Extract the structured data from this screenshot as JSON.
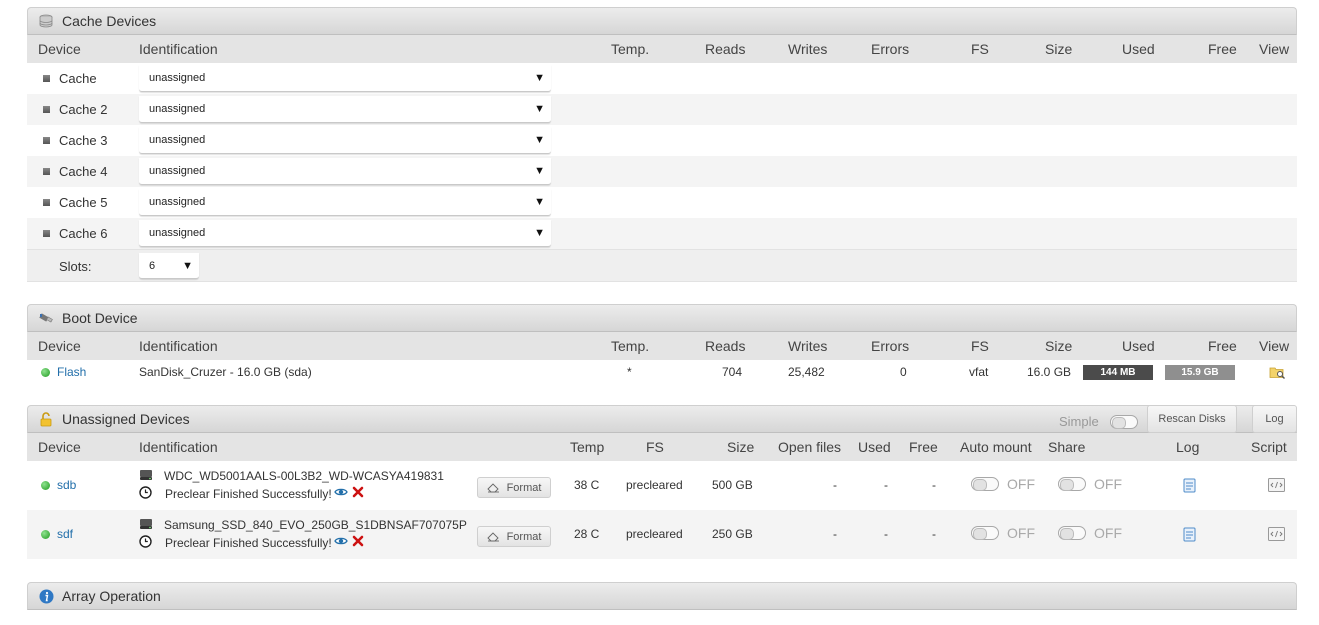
{
  "cache": {
    "title": "Cache Devices",
    "headers": {
      "device": "Device",
      "identification": "Identification",
      "temp": "Temp.",
      "reads": "Reads",
      "writes": "Writes",
      "errors": "Errors",
      "fs": "FS",
      "size": "Size",
      "used": "Used",
      "free": "Free",
      "view": "View"
    },
    "rows": [
      {
        "device": "Cache",
        "value": "unassigned"
      },
      {
        "device": "Cache 2",
        "value": "unassigned"
      },
      {
        "device": "Cache 3",
        "value": "unassigned"
      },
      {
        "device": "Cache 4",
        "value": "unassigned"
      },
      {
        "device": "Cache 5",
        "value": "unassigned"
      },
      {
        "device": "Cache 6",
        "value": "unassigned"
      }
    ],
    "slots_label": "Slots:",
    "slots_value": "6"
  },
  "boot": {
    "title": "Boot Device",
    "headers": {
      "device": "Device",
      "identification": "Identification",
      "temp": "Temp.",
      "reads": "Reads",
      "writes": "Writes",
      "errors": "Errors",
      "fs": "FS",
      "size": "Size",
      "used": "Used",
      "free": "Free",
      "view": "View"
    },
    "row": {
      "device": "Flash",
      "identification": "SanDisk_Cruzer - 16.0 GB (sda)",
      "temp": "*",
      "reads": "704",
      "writes": "25,482",
      "errors": "0",
      "fs": "vfat",
      "size": "16.0 GB",
      "used": "144 MB",
      "free": "15.9 GB"
    }
  },
  "unassigned": {
    "title": "Unassigned Devices",
    "simple_label": "Simple",
    "rescan_label": "Rescan Disks",
    "log_label": "Log",
    "headers": {
      "device": "Device",
      "identification": "Identification",
      "temp": "Temp",
      "fs": "FS",
      "size": "Size",
      "open_files": "Open files",
      "used": "Used",
      "free": "Free",
      "auto_mount": "Auto mount",
      "share": "Share",
      "log": "Log",
      "script": "Script"
    },
    "rows": [
      {
        "device": "sdb",
        "id": "WDC_WD5001AALS-00L3B2_WD-WCASYA419831",
        "status": "Preclear Finished Successfully!",
        "format": "Format",
        "temp": "38 C",
        "fs": "precleared",
        "size": "500 GB",
        "open_files": "-",
        "used": "-",
        "free": "-",
        "auto_mount": "OFF",
        "share": "OFF"
      },
      {
        "device": "sdf",
        "id": "Samsung_SSD_840_EVO_250GB_S1DBNSAF707075P",
        "status": "Preclear Finished Successfully!",
        "format": "Format",
        "temp": "28 C",
        "fs": "precleared",
        "size": "250 GB",
        "open_files": "-",
        "used": "-",
        "free": "-",
        "auto_mount": "OFF",
        "share": "OFF"
      }
    ]
  },
  "array": {
    "title": "Array Operation"
  },
  "icons": {
    "cache": "database-icon",
    "boot": "usb-icon",
    "unassigned": "unlock-icon",
    "array": "info-icon",
    "view": "folder-search-icon",
    "drive": "hard-drive-icon",
    "clock": "clock-icon",
    "eye": "eye-icon",
    "remove": "remove-x-icon",
    "log": "log-file-icon",
    "script": "script-icon",
    "format": "eraser-icon"
  },
  "colors": {
    "link": "#226faa",
    "status_green": "#1f9a1f",
    "remove_red": "#cc1111",
    "used_bar": "#4b4b4b",
    "free_bar": "#8f8f8f"
  }
}
